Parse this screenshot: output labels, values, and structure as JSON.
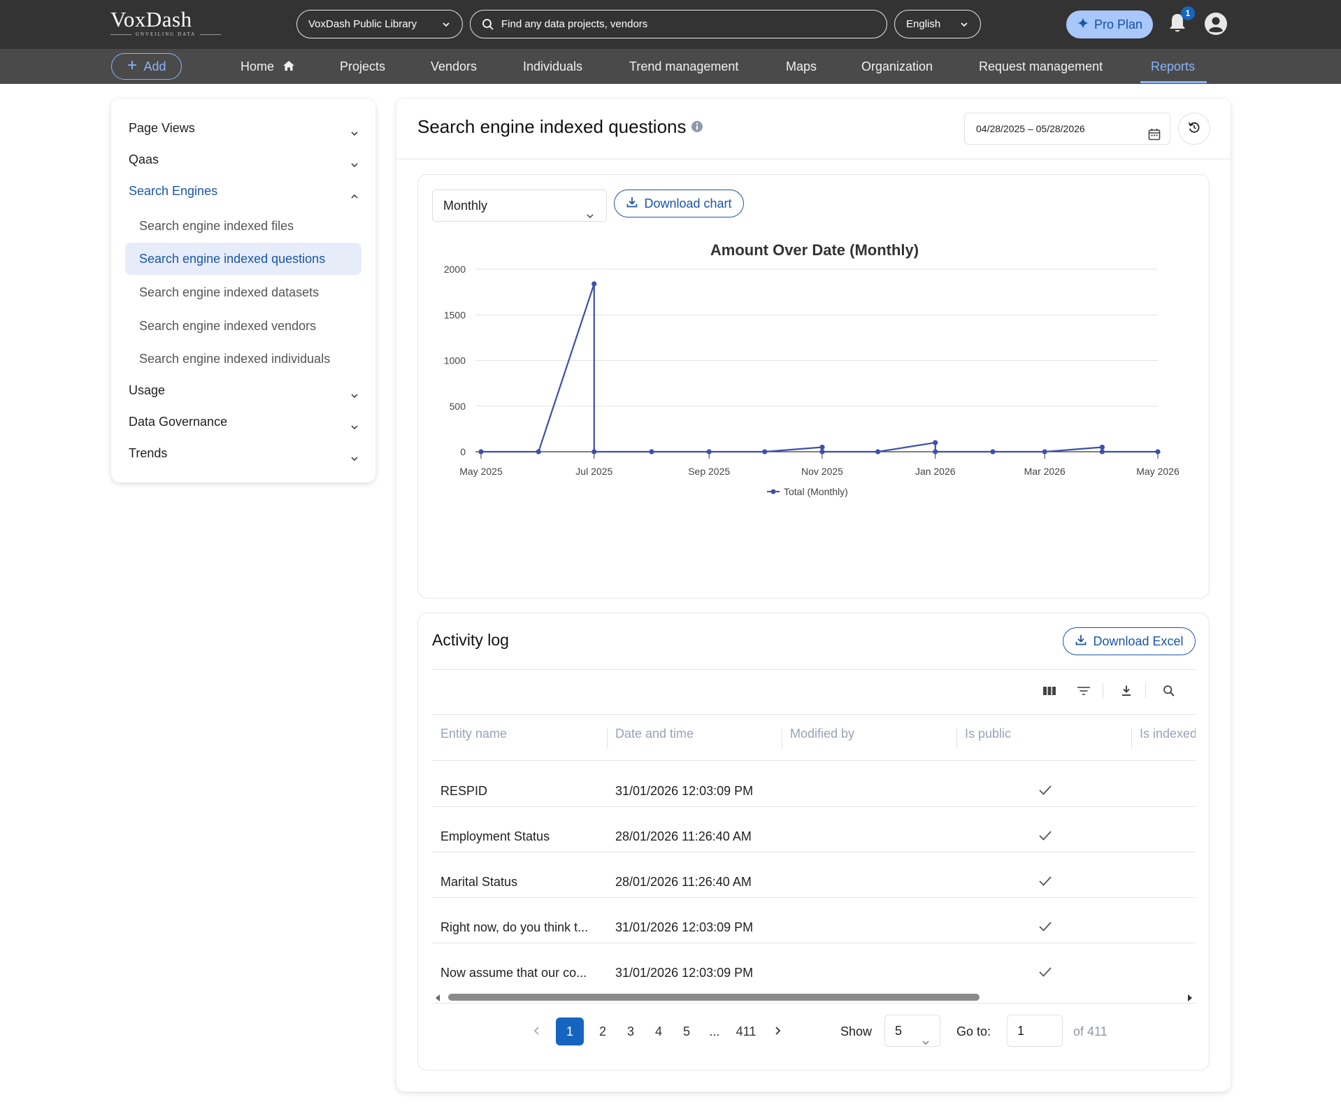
{
  "brand": {
    "name": "VoxDash",
    "tagline": "UNVEILING DATA"
  },
  "topbar": {
    "library_select": "VoxDash Public Library",
    "search_placeholder": "Find any data projects, vendors",
    "language": "English",
    "pro_plan_label": "Pro Plan",
    "notification_count": "1"
  },
  "nav": {
    "add_label": "Add",
    "items": [
      "Home",
      "Projects",
      "Vendors",
      "Individuals",
      "Trend management",
      "Maps",
      "Organization",
      "Request management",
      "Reports"
    ],
    "active": "Reports"
  },
  "sidebar": {
    "sections": [
      {
        "label": "Page Views",
        "expanded": false
      },
      {
        "label": "Qaas",
        "expanded": false
      },
      {
        "label": "Search Engines",
        "expanded": true
      },
      {
        "label": "Usage",
        "expanded": false
      },
      {
        "label": "Data Governance",
        "expanded": false
      },
      {
        "label": "Trends",
        "expanded": false
      }
    ],
    "search_engine_items": [
      "Search engine indexed files",
      "Search engine indexed questions",
      "Search engine indexed datasets",
      "Search engine indexed vendors",
      "Search engine indexed individuals"
    ],
    "active_item": "Search engine indexed questions"
  },
  "main": {
    "title": "Search engine indexed questions",
    "date_range": "04/28/2025 – 05/28/2026",
    "period": "Monthly",
    "download_chart_label": "Download chart"
  },
  "chart_data": {
    "type": "line",
    "title": "Amount Over Date (Monthly)",
    "xlabel": "",
    "ylabel": "",
    "ylim": [
      0,
      2000
    ],
    "yticks": [
      0,
      500,
      1000,
      1500,
      2000
    ],
    "xticks": [
      "May 2025",
      "Jul 2025",
      "Sep 2025",
      "Nov 2025",
      "Jan 2026",
      "Mar 2026",
      "May 2026"
    ],
    "grid": true,
    "legend_position": "bottom",
    "series": [
      {
        "name": "Total (Monthly)",
        "color": "#3f4fa8",
        "points": [
          {
            "x": "2025-05-01",
            "y": 0
          },
          {
            "x": "2025-06-01",
            "y": 0
          },
          {
            "x": "2025-07-01",
            "y": 1840
          },
          {
            "x": "2025-07-01",
            "y": 0
          },
          {
            "x": "2025-08-01",
            "y": 0
          },
          {
            "x": "2025-09-01",
            "y": 0
          },
          {
            "x": "2025-10-01",
            "y": 0
          },
          {
            "x": "2025-11-01",
            "y": 50
          },
          {
            "x": "2025-11-01",
            "y": 0
          },
          {
            "x": "2025-12-01",
            "y": 0
          },
          {
            "x": "2026-01-01",
            "y": 100
          },
          {
            "x": "2026-01-01",
            "y": 0
          },
          {
            "x": "2026-02-01",
            "y": 0
          },
          {
            "x": "2026-03-01",
            "y": 0
          },
          {
            "x": "2026-04-01",
            "y": 50
          },
          {
            "x": "2026-04-01",
            "y": 0
          },
          {
            "x": "2026-05-01",
            "y": 0
          }
        ]
      }
    ]
  },
  "activity_log": {
    "title": "Activity log",
    "download_excel_label": "Download Excel",
    "columns": [
      "Entity name",
      "Date and time",
      "Modified by",
      "Is public",
      "Is indexed"
    ],
    "rows": [
      {
        "entity": "RESPID",
        "datetime": "31/01/2026 12:03:09 PM",
        "modified_by": "",
        "is_public": true
      },
      {
        "entity": "Employment Status",
        "datetime": "28/01/2026 11:26:40 AM",
        "modified_by": "",
        "is_public": true
      },
      {
        "entity": "Marital Status",
        "datetime": "28/01/2026 11:26:40 AM",
        "modified_by": "",
        "is_public": true
      },
      {
        "entity": "Right now, do you think t...",
        "datetime": "31/01/2026 12:03:09 PM",
        "modified_by": "",
        "is_public": true
      },
      {
        "entity": "Now assume that our co...",
        "datetime": "31/01/2026 12:03:09 PM",
        "modified_by": "",
        "is_public": true
      }
    ],
    "pagination": {
      "pages": [
        "1",
        "2",
        "3",
        "4",
        "5",
        "...",
        "411"
      ],
      "current": "1",
      "show_label": "Show",
      "page_size": "5",
      "goto_label": "Go to:",
      "goto_value": "1",
      "of_label": "of 411"
    }
  },
  "colors": {
    "accent": "#1a55a8",
    "topbar": "#333333",
    "navbar": "#4a4a4a",
    "pro": "#a8c7fa",
    "series": "#3f4fa8"
  }
}
